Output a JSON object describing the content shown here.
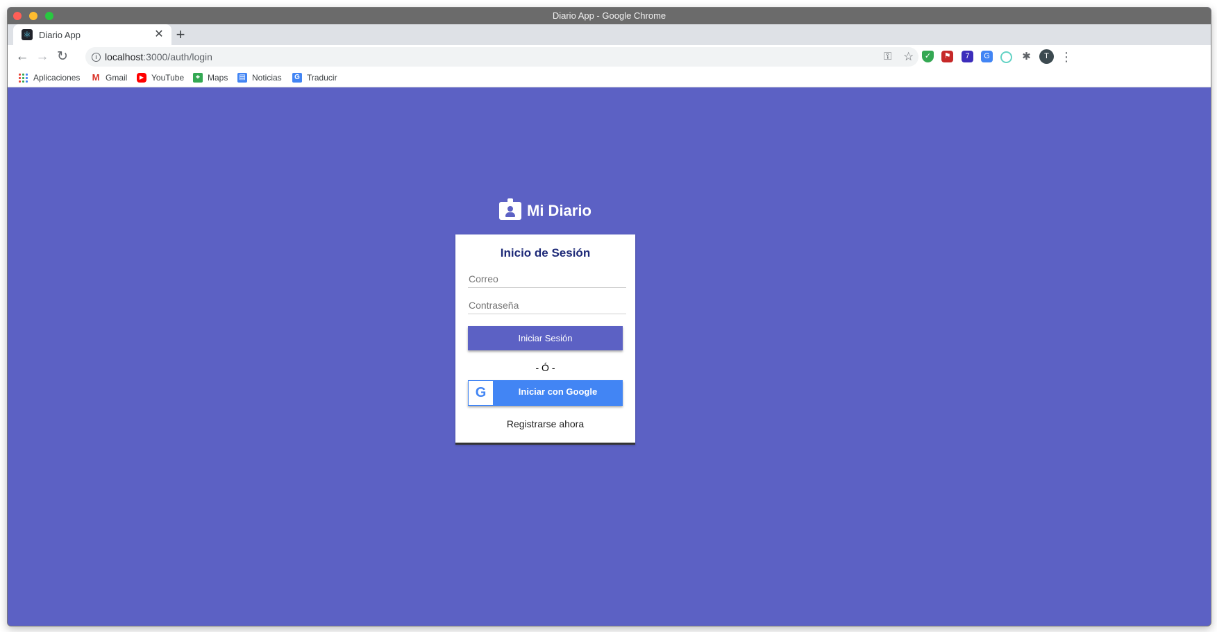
{
  "window": {
    "title": "Diario App - Google Chrome"
  },
  "tab": {
    "title": "Diario App"
  },
  "omnibox": {
    "host": "localhost",
    "path": ":3000/auth/login"
  },
  "bookmarks": [
    {
      "label": "Aplicaciones",
      "icon": "apps-icon"
    },
    {
      "label": "Gmail",
      "icon": "gmail-icon"
    },
    {
      "label": "YouTube",
      "icon": "youtube-icon"
    },
    {
      "label": "Maps",
      "icon": "maps-icon"
    },
    {
      "label": "Noticias",
      "icon": "news-icon"
    },
    {
      "label": "Traducir",
      "icon": "translate-icon"
    }
  ],
  "extensions": {
    "badge_count": "7",
    "avatar_initial": "T"
  },
  "colors": {
    "background": "#5c61c4",
    "google_blue": "#4285f4",
    "title_color": "#1e2a78"
  },
  "brand": {
    "title": "Mi Diario"
  },
  "login": {
    "heading": "Inicio de Sesión",
    "email_placeholder": "Correo",
    "password_placeholder": "Contraseña",
    "submit_label": "Iniciar Sesión",
    "or_label": "- Ó -",
    "google_label": "Iniciar con Google",
    "register_label": "Registrarse ahora"
  }
}
